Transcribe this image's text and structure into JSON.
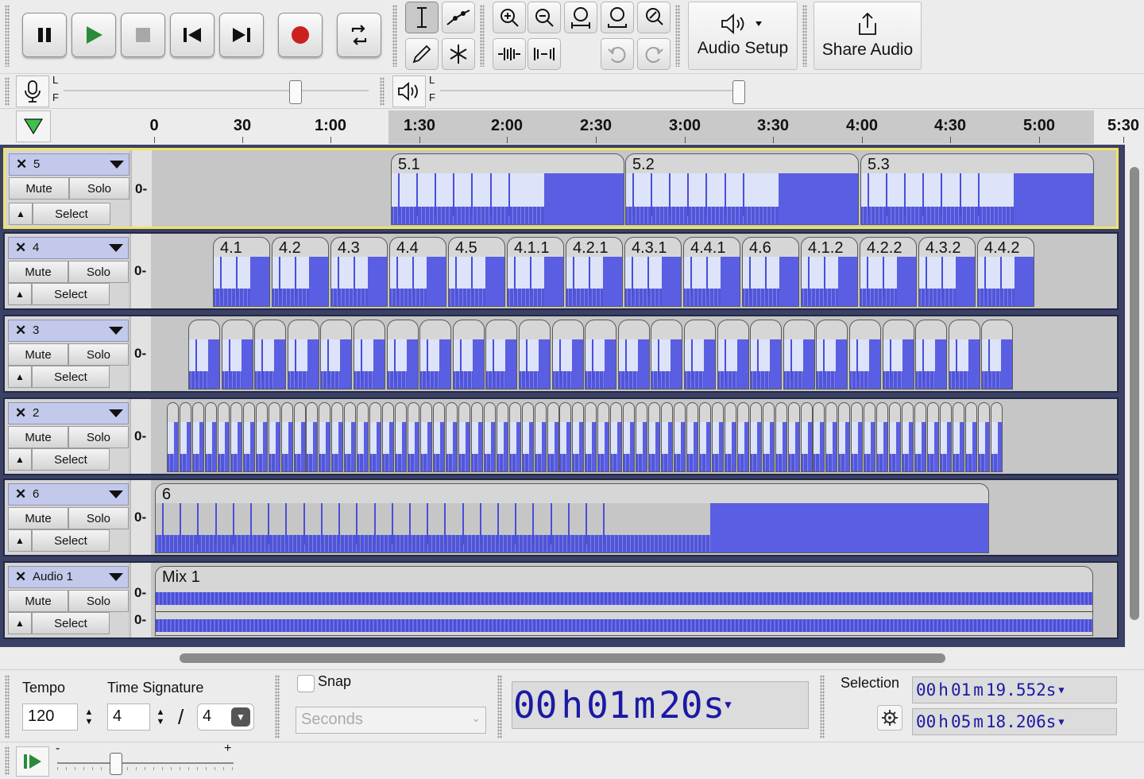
{
  "toolbar": {
    "transport": [
      "pause-button",
      "play-button",
      "stop-button",
      "skip-start-button",
      "skip-end-button",
      "record-button",
      "loop-button"
    ],
    "audio_setup_label": "Audio Setup",
    "share_audio_label": "Share Audio"
  },
  "meters": {
    "rec_l": "L",
    "rec_r": "F",
    "play_l": "L",
    "play_r": "F"
  },
  "ruler": {
    "ticks": [
      "0",
      "30",
      "1:00",
      "1:30",
      "2:00",
      "2:30",
      "3:00",
      "3:30",
      "4:00",
      "4:30",
      "5:00",
      "5:30"
    ]
  },
  "tracks": [
    {
      "name": "5",
      "mute": "Mute",
      "solo": "Solo",
      "select": "Select",
      "zero": "0-",
      "clips": [
        "5.1",
        "5.2",
        "5.3"
      ]
    },
    {
      "name": "4",
      "mute": "Mute",
      "solo": "Solo",
      "select": "Select",
      "zero": "0-",
      "clips": [
        "4.1",
        "4.2",
        "4.3",
        "4.4",
        "4.5",
        "4.1.1",
        "4.2.1",
        "4.3.1",
        "4.4.1",
        "4.6",
        "4.1.2",
        "4.2.2",
        "4.3.2",
        "4.4.2"
      ]
    },
    {
      "name": "3",
      "mute": "Mute",
      "solo": "Solo",
      "select": "Select",
      "zero": "0-"
    },
    {
      "name": "2",
      "mute": "Mute",
      "solo": "Solo",
      "select": "Select",
      "zero": "0-"
    },
    {
      "name": "6",
      "mute": "Mute",
      "solo": "Solo",
      "select": "Select",
      "zero": "0-",
      "clips": [
        "6"
      ]
    },
    {
      "name": "Audio 1",
      "mute": "Mute",
      "solo": "Solo",
      "select": "Select",
      "zero": "0-",
      "zero2": "0-",
      "clips": [
        "Mix 1"
      ]
    }
  ],
  "bottom": {
    "tempo_label": "Tempo",
    "tempo_value": "120",
    "timesig_label": "Time Signature",
    "timesig_num": "4",
    "timesig_slash": "/",
    "timesig_den": "4",
    "snap_label": "Snap",
    "snap_unit": "Seconds",
    "time": {
      "h": "00",
      "h_unit": "h",
      "m": "01",
      "m_unit": "m",
      "s": "20",
      "s_unit": "s"
    },
    "selection_label": "Selection",
    "sel_start": {
      "h": "00",
      "m": "01",
      "s": "19.552"
    },
    "sel_end": {
      "h": "00",
      "m": "05",
      "s": "18.206"
    },
    "unit_h": "h",
    "unit_m": "m",
    "unit_s": "s",
    "speed_minus": "-",
    "speed_plus": "+"
  }
}
